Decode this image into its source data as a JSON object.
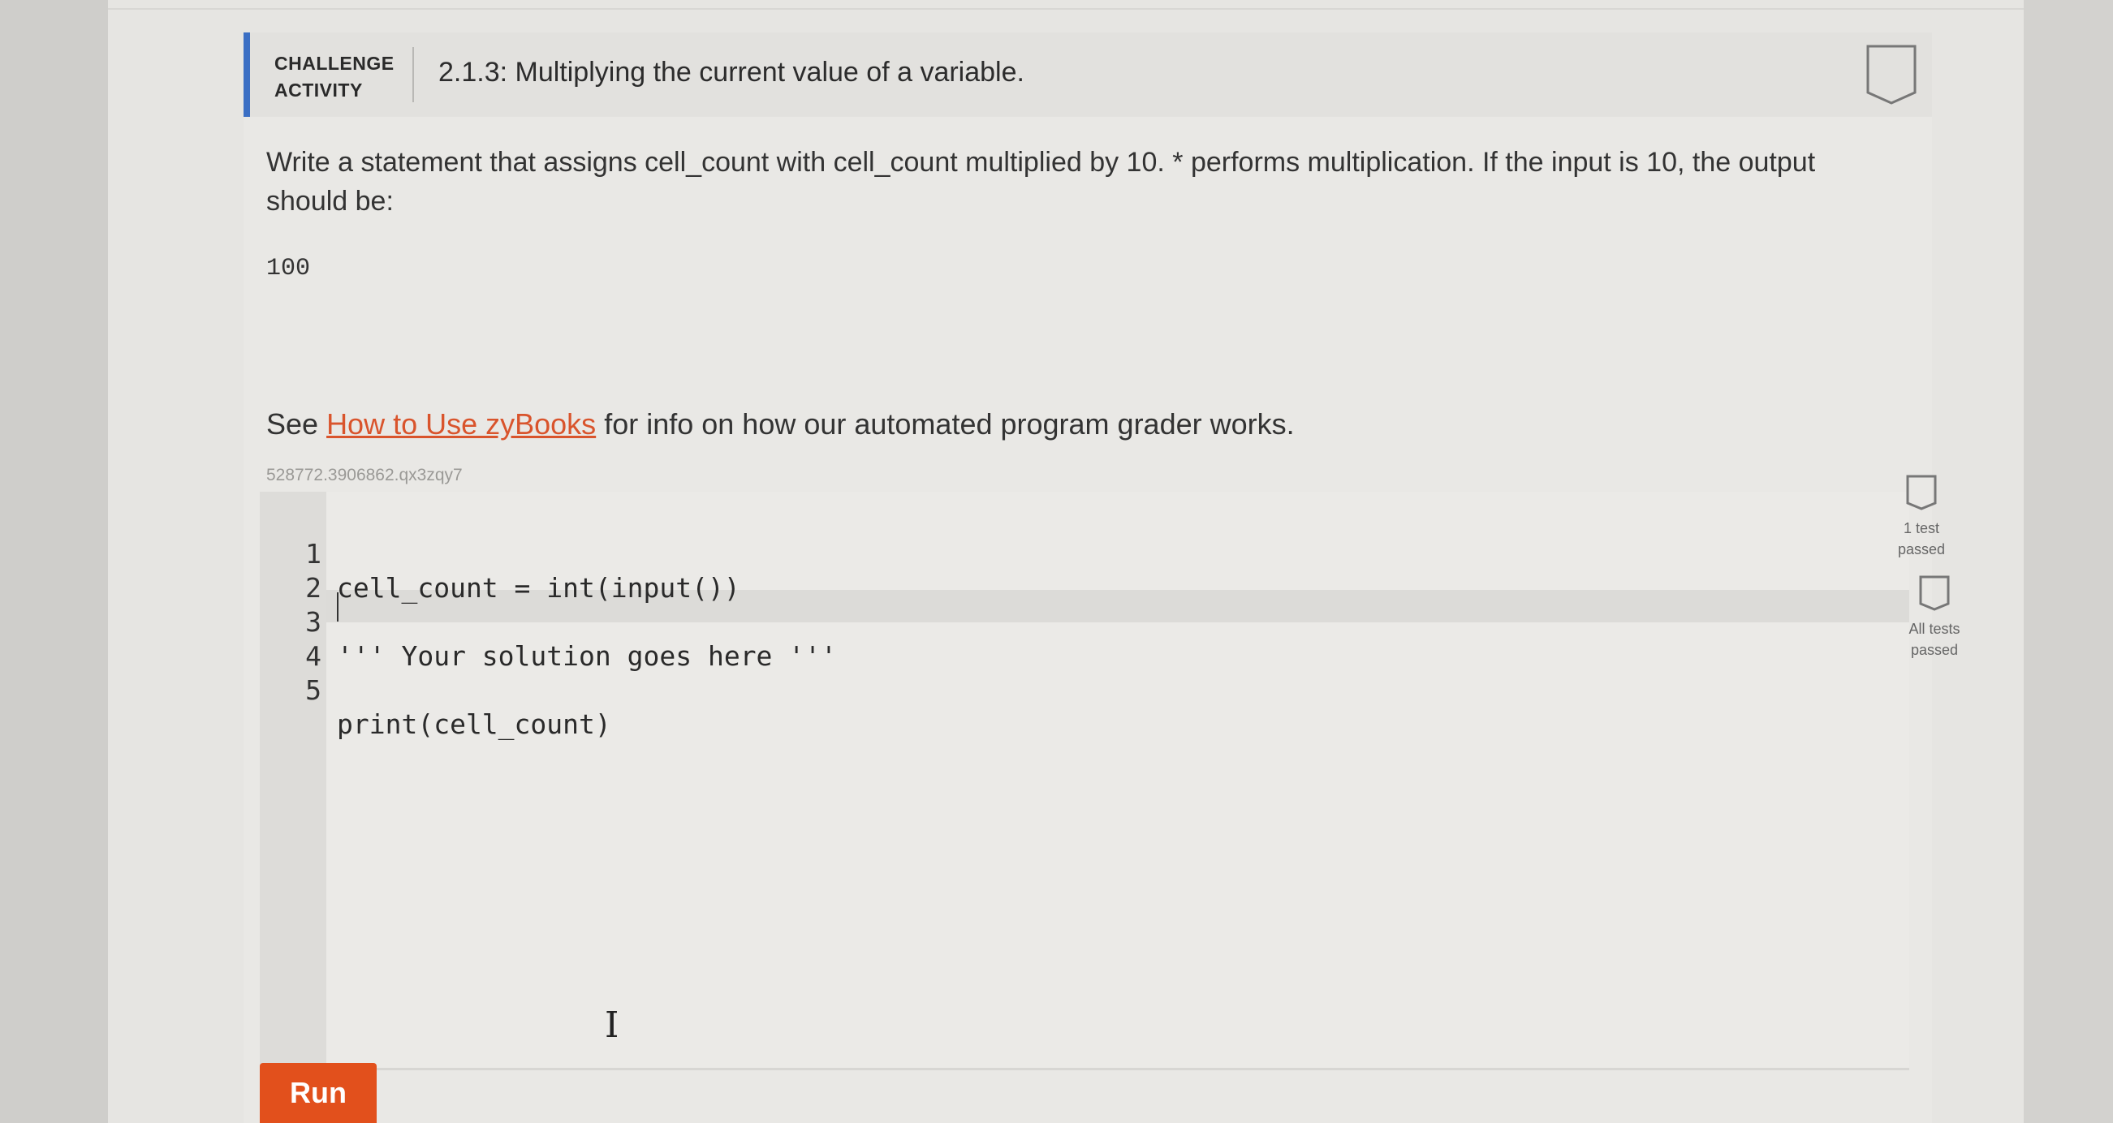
{
  "activity": {
    "label_line1": "CHALLENGE",
    "label_line2": "ACTIVITY",
    "title": "2.1.3: Multiplying the current value of a variable."
  },
  "prompt": {
    "description": "Write a statement that assigns cell_count with cell_count multiplied by 10. * performs multiplication. If the input is 10, the output should be:",
    "expected_output": "100",
    "see_prefix": "See ",
    "see_link": "How to Use zyBooks",
    "see_suffix": " for info on how our automated program grader works."
  },
  "snippet_id": "528772.3906862.qx3zqy7",
  "editor": {
    "lines": [
      {
        "num": "1",
        "code": "cell_count = int(input())"
      },
      {
        "num": "2",
        "code": ""
      },
      {
        "num": "3",
        "code": "''' Your solution goes here '''"
      },
      {
        "num": "4",
        "code": ""
      },
      {
        "num": "5",
        "code": "print(cell_count)"
      }
    ]
  },
  "status": {
    "test1_line1": "1 test",
    "test1_line2": "passed",
    "all_line1": "All tests",
    "all_line2": "passed"
  },
  "run_label": "Run",
  "colors": {
    "accent_bar": "#3b6fc4",
    "run_button": "#e2501c",
    "link": "#d9542c"
  }
}
